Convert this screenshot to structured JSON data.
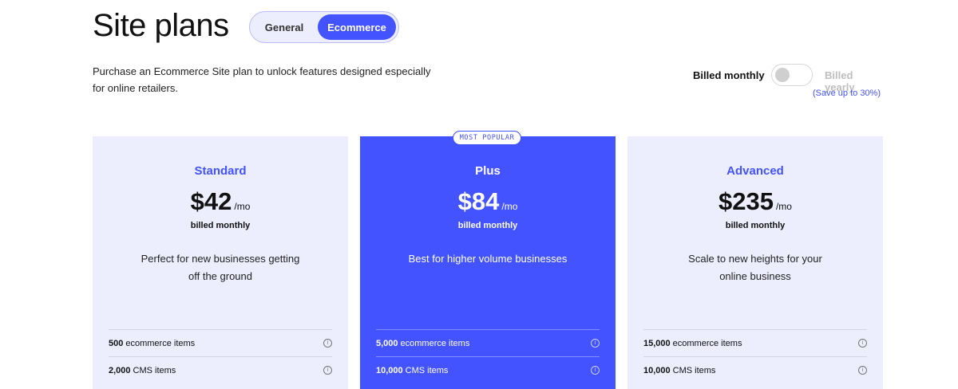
{
  "page_title": "Site plans",
  "plan_type_toggle": {
    "options": [
      "General",
      "Ecommerce"
    ],
    "selected": "Ecommerce"
  },
  "intro_line1": "Purchase an Ecommerce Site plan to unlock features designed especially",
  "intro_line2": "for online retailers.",
  "billing": {
    "monthly_label": "Billed monthly",
    "yearly_label": "Billed yearly",
    "save_note": "(Save up to 30%)",
    "yearly_enabled": false
  },
  "colors": {
    "accent": "#4353ff",
    "card_bg": "#eceefe"
  },
  "plans": [
    {
      "name": "Standard",
      "price": "$42",
      "unit": "/mo",
      "billed": "billed monthly",
      "desc_line1": "Perfect for new businesses getting",
      "desc_line2": "off the ground",
      "features": [
        {
          "qty": "500",
          "label": "ecommerce items"
        },
        {
          "qty": "2,000",
          "label": "CMS items"
        }
      ]
    },
    {
      "name": "Plus",
      "badge": "MOST POPULAR",
      "price": "$84",
      "unit": "/mo",
      "billed": "billed monthly",
      "desc_line1": "Best for higher volume businesses",
      "desc_line2": "",
      "features": [
        {
          "qty": "5,000",
          "label": "ecommerce items"
        },
        {
          "qty": "10,000",
          "label": "CMS items"
        }
      ]
    },
    {
      "name": "Advanced",
      "price": "$235",
      "unit": "/mo",
      "billed": "billed monthly",
      "desc_line1": "Scale to new heights for your",
      "desc_line2": "online business",
      "features": [
        {
          "qty": "15,000",
          "label": "ecommerce items"
        },
        {
          "qty": "10,000",
          "label": "CMS items"
        }
      ]
    }
  ]
}
